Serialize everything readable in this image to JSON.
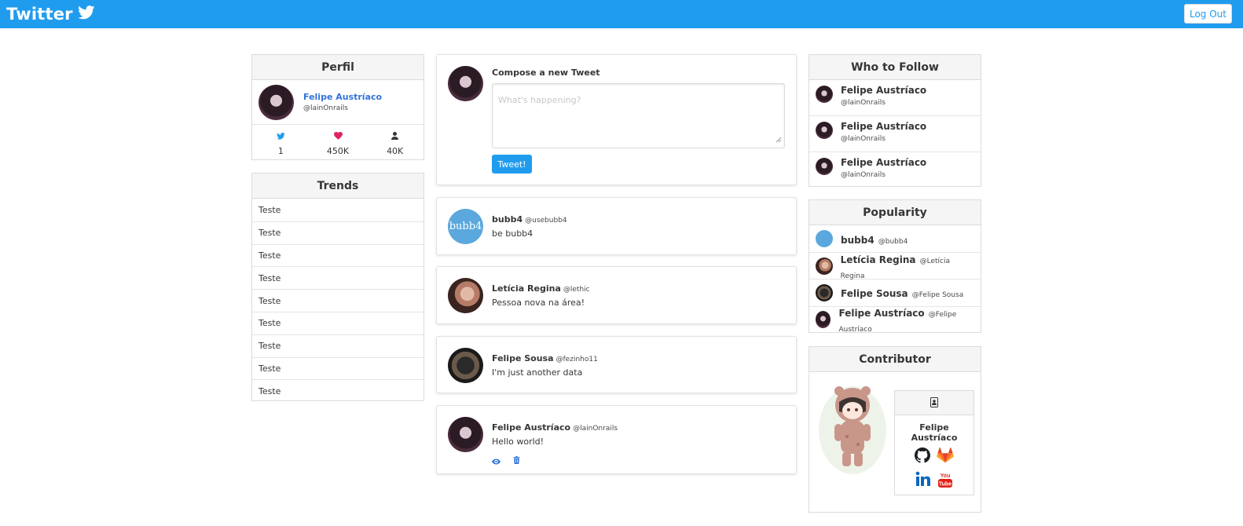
{
  "navbar": {
    "brand": "Twitter",
    "logout_label": "Log Out"
  },
  "profile": {
    "title": "Perfil",
    "name": "Felipe Austríaco",
    "handle": "@lainOnrails",
    "stats": [
      {
        "icon": "twitter-bird-icon",
        "value": "1"
      },
      {
        "icon": "heart-icon",
        "value": "450K"
      },
      {
        "icon": "user-icon",
        "value": "40K"
      }
    ]
  },
  "trends": {
    "title": "Trends",
    "items": [
      "Teste",
      "Teste",
      "Teste",
      "Teste",
      "Teste",
      "Teste",
      "Teste",
      "Teste",
      "Teste"
    ]
  },
  "compose": {
    "title": "Compose a new Tweet",
    "placeholder": "What's happening?",
    "button_label": "Tweet!"
  },
  "tweets": [
    {
      "name": "bubb4",
      "handle": "@usebubb4",
      "text": "be bubb4"
    },
    {
      "name": "Letícia Regina",
      "handle": "@lethic",
      "text": "Pessoa nova na área!"
    },
    {
      "name": "Felipe Sousa",
      "handle": "@fezinho11",
      "text": "I'm just another data"
    },
    {
      "name": "Felipe Austríaco",
      "handle": "@lainOnrails",
      "text": "Hello world!"
    }
  ],
  "who_to_follow": {
    "title": "Who to Follow",
    "items": [
      {
        "name": "Felipe Austríaco",
        "handle": "@lainOnrails"
      },
      {
        "name": "Felipe Austríaco",
        "handle": "@lainOnrails"
      },
      {
        "name": "Felipe Austríaco",
        "handle": "@lainOnrails"
      }
    ]
  },
  "popularity": {
    "title": "Popularity",
    "items": [
      {
        "name": "bubb4",
        "handle": "@bubb4"
      },
      {
        "name": "Letícia Regina",
        "handle": "@Letícia Regina"
      },
      {
        "name": "Felipe Sousa",
        "handle": "@Felipe Sousa"
      },
      {
        "name": "Felipe Austríaco",
        "handle": "@Felipe Austríaco"
      }
    ]
  },
  "contributor": {
    "title": "Contributor",
    "name": "Felipe Austríaco",
    "bubb4_logo": "bubb4"
  },
  "colors": {
    "accent": "#209cee",
    "heart": "#e0245e",
    "link": "#3273dc"
  }
}
